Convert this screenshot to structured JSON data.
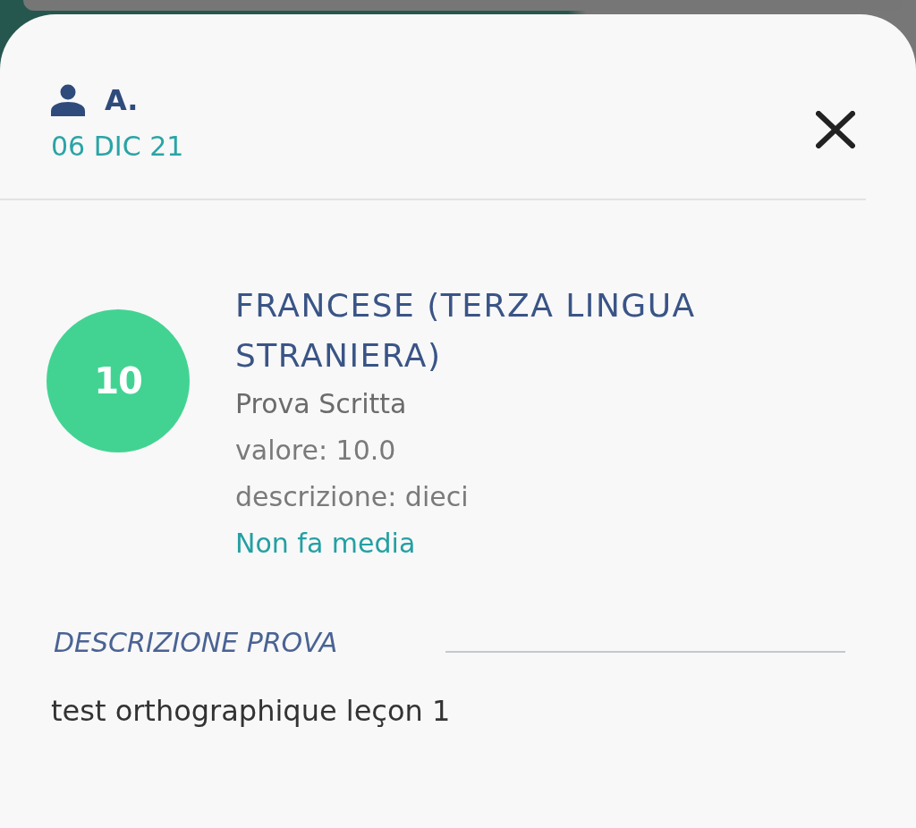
{
  "header": {
    "user": "A.",
    "date": "06 DIC 21"
  },
  "grade": {
    "value": "10"
  },
  "subject": "FRANCESE (TERZA LINGUA STRANIERA)",
  "type": "Prova Scritta",
  "details": [
    "valore: 10.0",
    "descrizione: dieci"
  ],
  "average_note": "Non fa media",
  "section": {
    "title": "DESCRIZIONE PROVA",
    "text": "test orthographique leçon 1"
  }
}
